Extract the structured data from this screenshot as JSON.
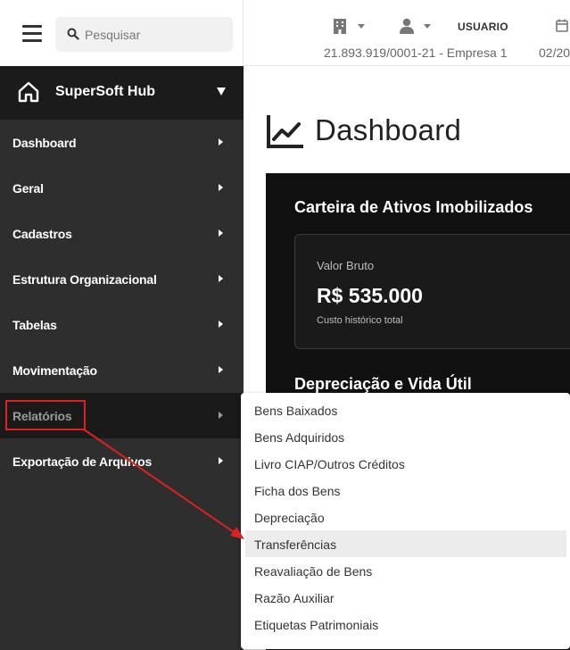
{
  "search": {
    "placeholder": "Pesquisar"
  },
  "hub": {
    "label": "SuperSoft Hub"
  },
  "menu": {
    "items": [
      {
        "label": "Dashboard"
      },
      {
        "label": "Geral"
      },
      {
        "label": "Cadastros"
      },
      {
        "label": "Estrutura Organizacional"
      },
      {
        "label": "Tabelas"
      },
      {
        "label": "Movimentação"
      },
      {
        "label": "Relatórios"
      },
      {
        "label": "Exportação de Arquivos"
      }
    ]
  },
  "header": {
    "username": "USUARIO",
    "company": "21.893.919/0001-21 - Empresa 1",
    "date": "02/20"
  },
  "page": {
    "title": "Dashboard"
  },
  "panel": {
    "title": "Carteira de Ativos Imobilizados",
    "card": {
      "label": "Valor Bruto",
      "value": "R$ 535.000",
      "sub": "Custo histórico total"
    },
    "title2": "Depreciação e Vida Útil"
  },
  "dropdown": {
    "items": [
      {
        "label": "Bens Baixados"
      },
      {
        "label": "Bens Adquiridos"
      },
      {
        "label": "Livro CIAP/Outros Créditos"
      },
      {
        "label": "Ficha dos Bens"
      },
      {
        "label": "Depreciação"
      },
      {
        "label": "Transferências"
      },
      {
        "label": "Reavaliação de Bens"
      },
      {
        "label": "Razão Auxiliar"
      },
      {
        "label": "Etiquetas Patrimoniais"
      }
    ]
  },
  "colors": {
    "sidebar_bg": "#2e2e2e",
    "hub_bg": "#1b1b1b",
    "active_bg": "#1a1a1a",
    "panel_bg": "#111111",
    "annotation": "#e02020",
    "hover_bg": "#ececec"
  },
  "icons": [
    "hamburger-icon",
    "search-icon",
    "home-icon",
    "building-icon",
    "user-icon",
    "calendar-icon",
    "chart-line-icon",
    "chevron-right-icon",
    "chevron-down-icon"
  ]
}
